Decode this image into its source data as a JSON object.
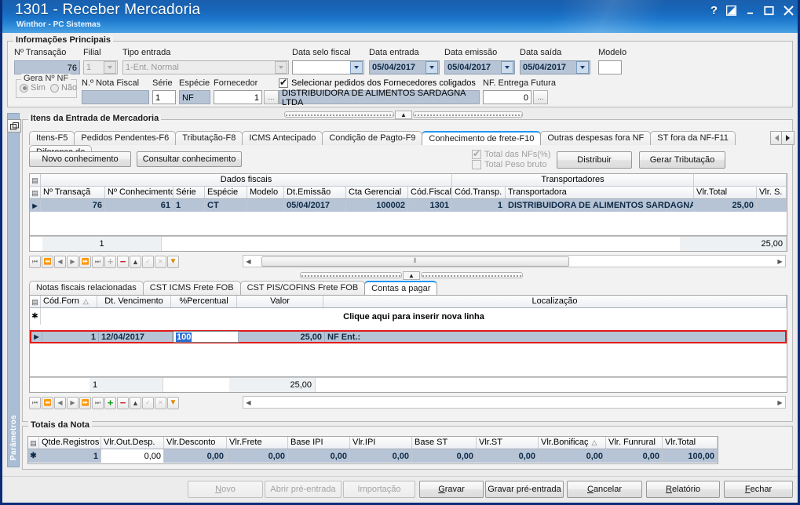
{
  "window": {
    "title": "1301 - Receber Mercadoria",
    "subtitle": "Winthor - PC Sistemas",
    "help_icon": "?",
    "restore_icon": "restore",
    "minimize_icon": "minimize",
    "maximize_icon": "maximize",
    "close_icon": "close"
  },
  "info_panel": {
    "legend": "Informações Principais",
    "transacao_label": "Nº Transação",
    "transacao_value": "76",
    "filial_label": "Filial",
    "filial_value": "1",
    "tipo_entrada_label": "Tipo entrada",
    "tipo_entrada_value": "1-Ent. Normal",
    "data_selo_label": "Data selo fiscal",
    "data_selo_value": "",
    "data_entrada_label": "Data entrada",
    "data_entrada_value": "05/04/2017",
    "data_emissao_label": "Data emissão",
    "data_emissao_value": "05/04/2017",
    "data_saida_label": "Data saída",
    "data_saida_value": "05/04/2017",
    "modelo_label": "Modelo",
    "modelo_value": "",
    "gera_nf_label": "Gera Nº NF",
    "gera_nf_sim": "Sim",
    "gera_nf_nao": "Não",
    "nota_fiscal_label": "N.º Nota Fiscal",
    "nota_fiscal_value": "",
    "serie_label": "Série",
    "serie_value": "1",
    "especie_label": "Espécie",
    "especie_value": "NF",
    "fornecedor_label": "Fornecedor",
    "fornecedor_value": "1",
    "fornecedor_browse": "...",
    "fornecedor_nome": "DISTRIBUIDORA DE ALIMENTOS SARDAGNA LTDA",
    "coligados_label": "Selecionar pedidos dos Fornecedores coligados",
    "coligados_checked": true,
    "nf_entrega_label": "NF. Entrega Futura",
    "nf_entrega_value": "0",
    "nf_entrega_browse": "..."
  },
  "sidebar": {
    "label": "Parâmetros",
    "pin_icon": "restore-panel-icon"
  },
  "items_panel": {
    "legend": "Itens da Entrada de Mercadoria",
    "tabs": [
      {
        "label": "Itens-F5",
        "active": false
      },
      {
        "label": "Pedidos Pendentes-F6",
        "active": false
      },
      {
        "label": "Tributação-F8",
        "active": false
      },
      {
        "label": "ICMS Antecipado",
        "active": false
      },
      {
        "label": "Condição de Pagto-F9",
        "active": false
      },
      {
        "label": "Conhecimento de frete-F10",
        "active": true
      },
      {
        "label": "Outras despesas fora NF",
        "active": false
      },
      {
        "label": "ST fora da NF-F11",
        "active": false
      },
      {
        "label": "Diferença de ",
        "active": false
      }
    ],
    "toolbar": {
      "novo_conhecimento": "Novo conhecimento",
      "consultar_conhecimento": "Consultar conhecimento",
      "total_nfs_label": "Total das NFs(%)",
      "total_nfs_checked": true,
      "total_peso_label": "Total Peso bruto",
      "total_peso_checked": false,
      "distribuir": "Distribuir",
      "gerar_tributacao": "Gerar Tributação"
    }
  },
  "freight_grid": {
    "group_headers": [
      {
        "label": "Dados fiscais"
      },
      {
        "label": "Transportadores"
      },
      {
        "label": ""
      }
    ],
    "columns": [
      "Nº Transaçã",
      "Nº Conhecimento",
      "Série",
      "Espécie",
      "Modelo",
      "Dt.Emissão",
      "Cta Gerencial",
      "Cód.Fiscal",
      "Cód.Transp.",
      "Transportadora",
      "Vlr.Total",
      "Vlr. S."
    ],
    "rows": [
      {
        "selected": true,
        "cells": [
          "76",
          "61",
          "1",
          "CT",
          "",
          "05/04/2017",
          "100002",
          "1301",
          "1",
          "DISTRIBUIDORA DE ALIMENTOS SARDAGNA",
          "25,00",
          ""
        ]
      }
    ],
    "footer": [
      "",
      "1",
      "",
      "",
      "",
      "",
      "",
      "",
      "",
      "",
      "25,00",
      ""
    ],
    "scroll_thumb_glyph": "⦀"
  },
  "nav_toolbar_top": {
    "buttons": [
      "first",
      "prior",
      "back",
      "next",
      "forward",
      "last",
      "insert",
      "delete",
      "edit",
      "post",
      "cancel",
      "filter"
    ],
    "insert_enabled": false,
    "delete_enabled": true
  },
  "lower_tabs": [
    {
      "label": "Notas fiscais relacionadas",
      "active": false
    },
    {
      "label": "CST ICMS Frete FOB",
      "active": false
    },
    {
      "label": "CST PIS/COFINS Frete FOB",
      "active": false
    },
    {
      "label": "Contas a pagar",
      "active": true
    }
  ],
  "payables_grid": {
    "columns": [
      "Cód.Forn",
      "Dt. Vencimento",
      "%Percentual",
      "Valor",
      "Localização"
    ],
    "sort_indicator": "△",
    "insert_hint": "Clique aqui para inserir nova linha",
    "edit_row": {
      "cod_forn": "1",
      "dt_vencimento": "12/04/2017",
      "percentual": "100",
      "valor": "25,00",
      "localizacao": "NF Ent.:"
    },
    "footer": [
      "",
      "1",
      "",
      "25,00",
      ""
    ]
  },
  "totals_panel": {
    "legend": "Totais da Nota",
    "columns": [
      "Qtde.Registros",
      "Vlr.Out.Desp.",
      "Vlr.Desconto",
      "Vlr.Frete",
      "Base IPI",
      "Vlr.IPI",
      "Base ST",
      "Vlr.ST",
      "Vlr.Bonificaç",
      "Vlr. Funrural",
      "Vlr.Total"
    ],
    "sort_indicator": "△",
    "row": [
      "1",
      "0,00",
      "0,00",
      "0,00",
      "0,00",
      "0,00",
      "0,00",
      "0,00",
      "0,00",
      "0,00",
      "100,00"
    ]
  },
  "bottom_buttons": [
    {
      "label": "Novo",
      "accel": "N",
      "enabled": false
    },
    {
      "label": "Abrir pré-entrada",
      "accel": "t",
      "enabled": false
    },
    {
      "label": "Importação",
      "accel": "I",
      "enabled": false
    },
    {
      "label": "Gravar",
      "accel": "G",
      "enabled": true
    },
    {
      "label": "Gravar pré-entrada",
      "accel": "v",
      "enabled": true
    },
    {
      "label": "Cancelar",
      "accel": "C",
      "enabled": true
    },
    {
      "label": "Relatório",
      "accel": "R",
      "enabled": true
    },
    {
      "label": "Fechar",
      "accel": "F",
      "enabled": true
    }
  ],
  "colors": {
    "titlebar": "#1b74c9",
    "accent_border": "#0a2d7a",
    "grid_selection": "#b6c4d6",
    "edit_row_border": "#e01b1b",
    "active_tab_top": "#2196f3",
    "sidebar": "#a9bdd4"
  }
}
